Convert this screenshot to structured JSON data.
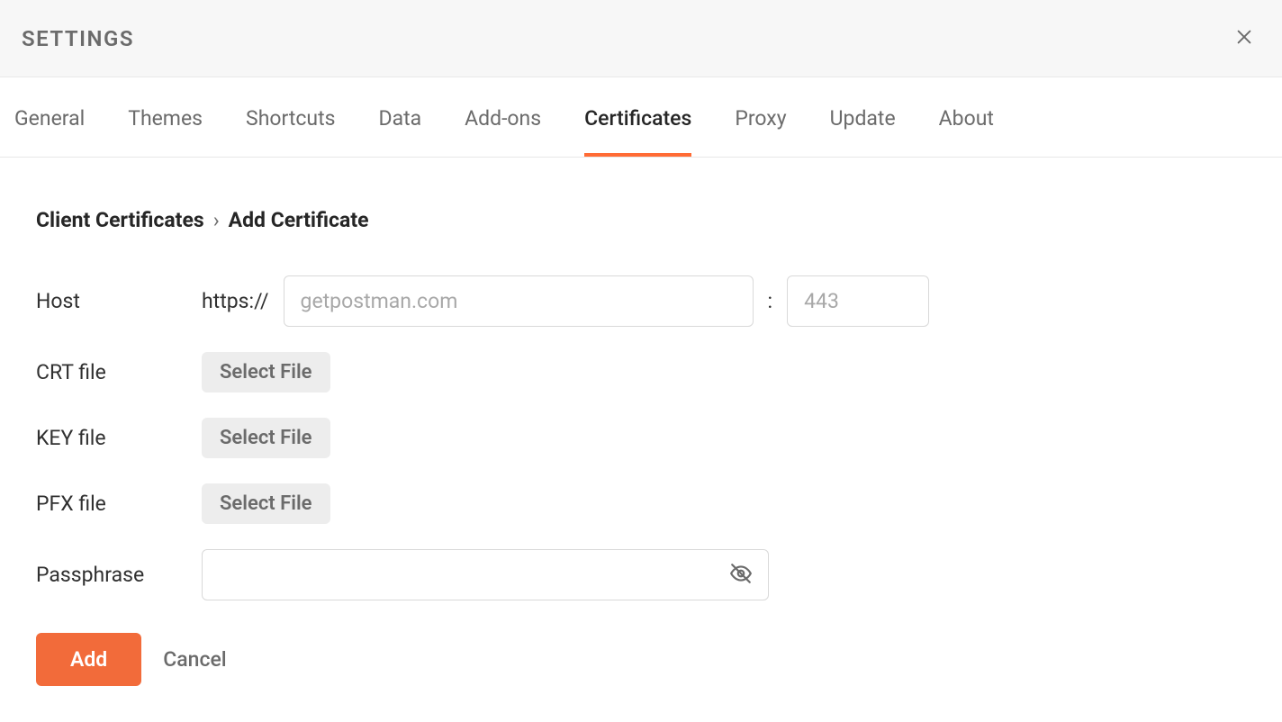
{
  "header": {
    "title": "SETTINGS"
  },
  "tabs": {
    "general": "General",
    "themes": "Themes",
    "shortcuts": "Shortcuts",
    "data": "Data",
    "addons": "Add-ons",
    "certificates": "Certificates",
    "proxy": "Proxy",
    "update": "Update",
    "about": "About"
  },
  "breadcrumb": {
    "parent": "Client Certificates",
    "separator": "›",
    "current": "Add Certificate"
  },
  "form": {
    "host_label": "Host",
    "protocol": "https://",
    "host_placeholder": "getpostman.com",
    "host_value": "",
    "colon": ":",
    "port_placeholder": "443",
    "port_value": "",
    "crt_label": "CRT file",
    "key_label": "KEY file",
    "pfx_label": "PFX file",
    "select_file": "Select File",
    "passphrase_label": "Passphrase",
    "passphrase_value": ""
  },
  "actions": {
    "add": "Add",
    "cancel": "Cancel"
  }
}
